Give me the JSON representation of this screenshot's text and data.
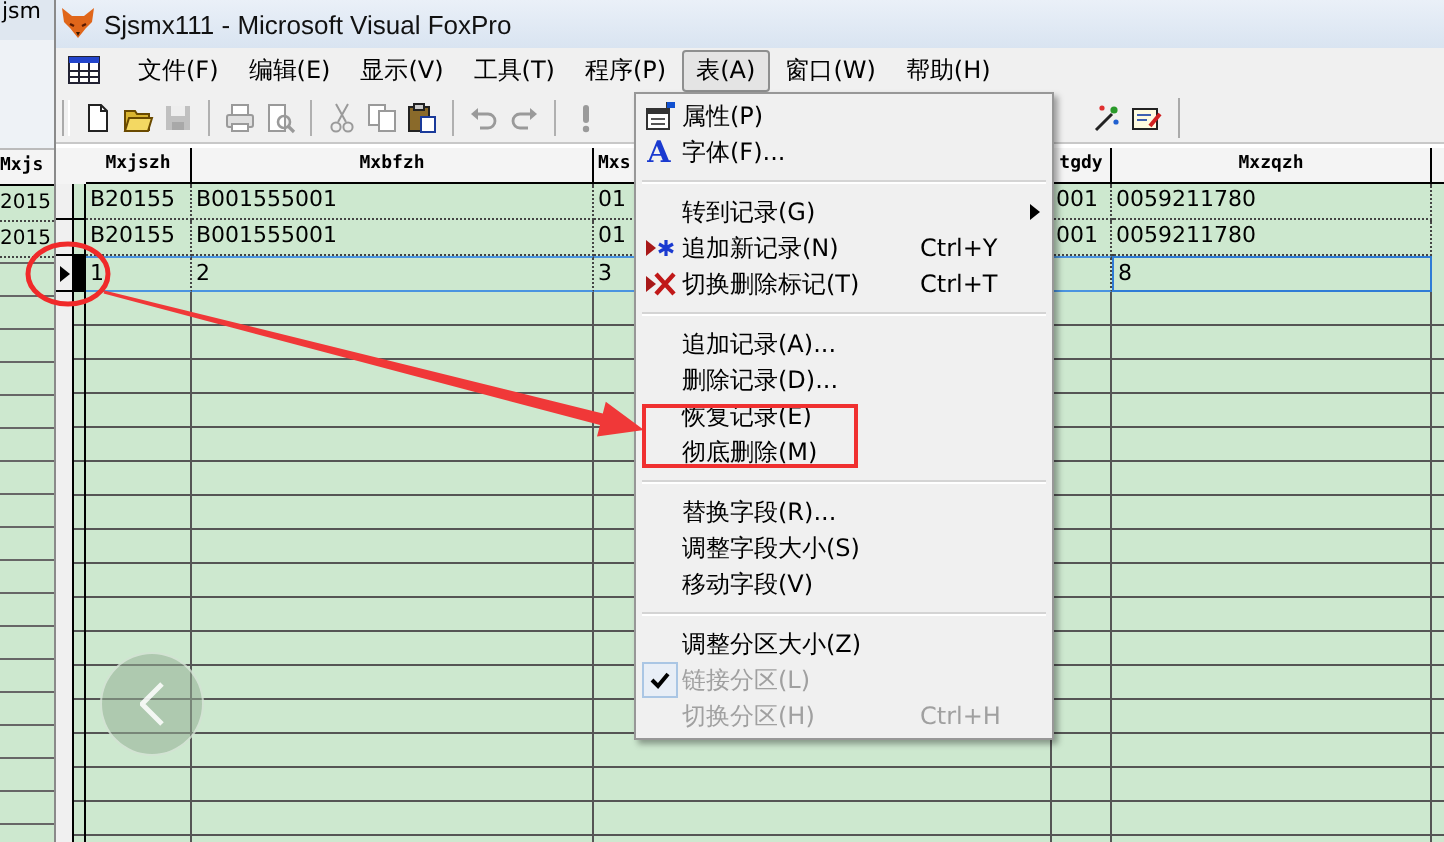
{
  "background_window": {
    "title": "jsm",
    "column": "Mxjs",
    "cells": [
      "2015",
      "2015"
    ]
  },
  "window": {
    "title": "Sjsmx111 - Microsoft Visual FoxPro"
  },
  "menu_bar": [
    {
      "label": "文件(F)",
      "selected": false
    },
    {
      "label": "编辑(E)",
      "selected": false
    },
    {
      "label": "显示(V)",
      "selected": false
    },
    {
      "label": "工具(T)",
      "selected": false
    },
    {
      "label": "程序(P)",
      "selected": false
    },
    {
      "label": "表(A)",
      "selected": true
    },
    {
      "label": "窗口(W)",
      "selected": false
    },
    {
      "label": "帮助(H)",
      "selected": false
    }
  ],
  "toolbar": {
    "left": [
      {
        "kind": "new",
        "disabled": false
      },
      {
        "kind": "open",
        "disabled": false
      },
      {
        "kind": "save",
        "disabled": true
      },
      {
        "kind": "separator"
      },
      {
        "kind": "print",
        "disabled": true
      },
      {
        "kind": "preview",
        "disabled": true
      },
      {
        "kind": "separator"
      },
      {
        "kind": "cut",
        "disabled": true
      },
      {
        "kind": "copy",
        "disabled": true
      },
      {
        "kind": "paste",
        "disabled": false
      },
      {
        "kind": "separator"
      },
      {
        "kind": "undo",
        "disabled": true
      },
      {
        "kind": "redo",
        "disabled": true
      },
      {
        "kind": "separator"
      },
      {
        "kind": "run",
        "disabled": true
      }
    ],
    "right": [
      {
        "kind": "wizard",
        "disabled": false
      },
      {
        "kind": "form",
        "disabled": false
      }
    ]
  },
  "table": {
    "columns": [
      "Mxjszh",
      "Mxbfzh",
      "Mxs",
      "tgdy",
      "Mxzqzh"
    ],
    "rows": [
      {
        "current": false,
        "cells": [
          {
            "text": "B20155",
            "focused": false
          },
          {
            "text": "B001555001",
            "focused": false
          },
          {
            "text": "01",
            "focused": false
          },
          {
            "text": "001",
            "focused": false
          },
          {
            "text": "0059211780",
            "focused": false
          }
        ]
      },
      {
        "current": false,
        "cells": [
          {
            "text": "B20155",
            "focused": false
          },
          {
            "text": "B001555001",
            "focused": false
          },
          {
            "text": "01",
            "focused": false
          },
          {
            "text": "001",
            "focused": false
          },
          {
            "text": "0059211780",
            "focused": false
          }
        ]
      },
      {
        "current": true,
        "cells": [
          {
            "text": "1",
            "focused": false
          },
          {
            "text": "2",
            "focused": false
          },
          {
            "text": "3",
            "focused": false
          },
          {
            "focused": false
          },
          {
            "text": "8",
            "focused": true
          }
        ]
      }
    ]
  },
  "menu": {
    "items": [
      {
        "kind": "properties",
        "label": "属性(P)",
        "checked": false,
        "disabled": false,
        "submenu": false
      },
      {
        "kind": "font",
        "label": "字体(F)...",
        "icon_text": "A",
        "checked": false,
        "disabled": false,
        "submenu": false
      },
      {
        "kind": "separator"
      },
      {
        "kind": "item",
        "label": "转到记录(G)",
        "checked": false,
        "disabled": false,
        "submenu": true
      },
      {
        "kind": "append",
        "label": "追加新记录(N)",
        "shortcut": "Ctrl+Y",
        "checked": false,
        "disabled": false,
        "submenu": false
      },
      {
        "kind": "delete-mark",
        "label": "切换删除标记(T)",
        "shortcut": "Ctrl+T",
        "checked": false,
        "disabled": false,
        "submenu": false
      },
      {
        "kind": "separator"
      },
      {
        "kind": "item",
        "label": "追加记录(A)...",
        "checked": false,
        "disabled": false,
        "submenu": false
      },
      {
        "kind": "item",
        "label": "删除记录(D)...",
        "checked": false,
        "disabled": false,
        "submenu": false
      },
      {
        "kind": "item",
        "label": "恢复记录(E)",
        "checked": false,
        "disabled": false,
        "submenu": false
      },
      {
        "kind": "item",
        "label": "彻底删除(M)",
        "checked": false,
        "disabled": false,
        "submenu": false
      },
      {
        "kind": "separator"
      },
      {
        "kind": "item",
        "label": "替换字段(R)...",
        "checked": false,
        "disabled": false,
        "submenu": false
      },
      {
        "kind": "item",
        "label": "调整字段大小(S)",
        "checked": false,
        "disabled": false,
        "submenu": false
      },
      {
        "kind": "item",
        "label": "移动字段(V)",
        "checked": false,
        "disabled": false,
        "submenu": false
      },
      {
        "kind": "separator"
      },
      {
        "kind": "item",
        "label": "调整分区大小(Z)",
        "checked": false,
        "disabled": false,
        "submenu": false
      },
      {
        "kind": "item",
        "label": "链接分区(L)",
        "checked": true,
        "disabled": true,
        "submenu": false
      },
      {
        "kind": "item",
        "label": "切换分区(H)",
        "shortcut": "Ctrl+H",
        "checked": false,
        "disabled": true,
        "submenu": false
      }
    ]
  }
}
